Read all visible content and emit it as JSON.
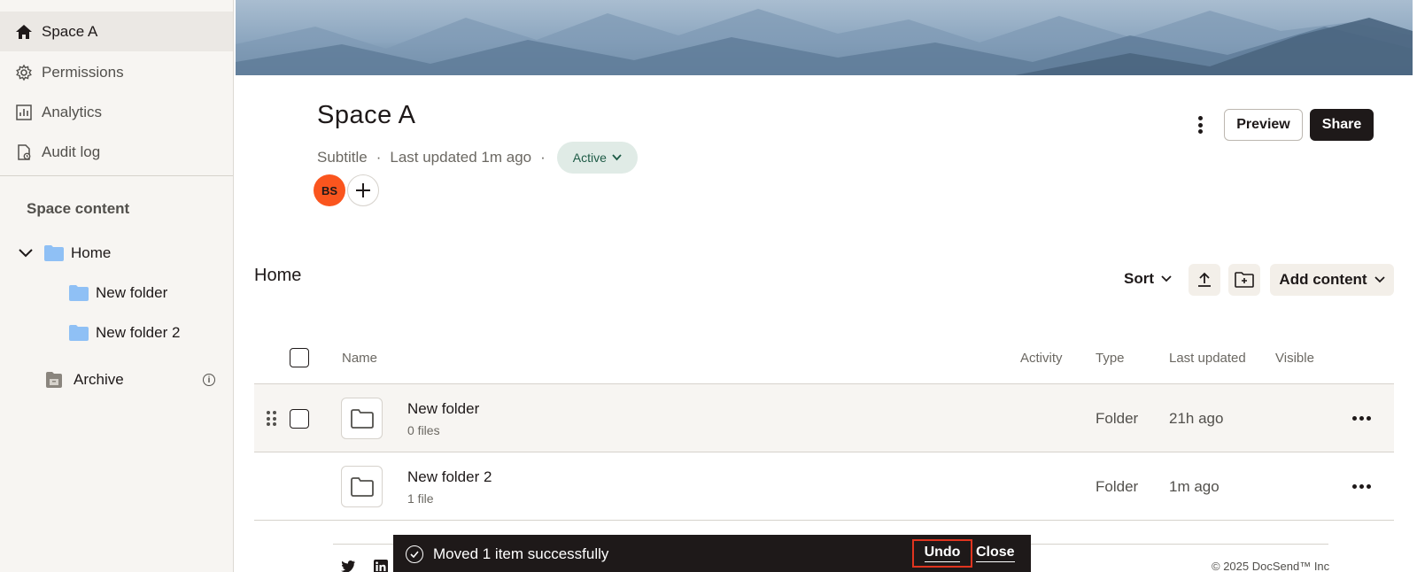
{
  "sidebar": {
    "nav": [
      {
        "label": "Space A",
        "icon": "home-icon",
        "active": true
      },
      {
        "label": "Permissions",
        "icon": "gear-icon"
      },
      {
        "label": "Analytics",
        "icon": "chart-icon"
      },
      {
        "label": "Audit log",
        "icon": "audit-log-icon"
      }
    ],
    "section_title": "Space content",
    "tree": {
      "home": "Home",
      "children": [
        "New folder",
        "New folder 2"
      ],
      "archive": "Archive"
    }
  },
  "header": {
    "title": "Space A",
    "subtitle": "Subtitle",
    "last_updated": "Last updated 1m ago",
    "status": "Active",
    "avatar_initials": "BS",
    "preview_label": "Preview",
    "share_label": "Share"
  },
  "toolbar": {
    "folder_title": "Home",
    "sort_label": "Sort",
    "add_content_label": "Add content"
  },
  "table": {
    "columns": [
      "Name",
      "Activity",
      "Type",
      "Last updated",
      "Visible"
    ],
    "rows": [
      {
        "name": "New folder",
        "sub": "0 files",
        "type": "Folder",
        "updated": "21h ago"
      },
      {
        "name": "New folder 2",
        "sub": "1 file",
        "type": "Folder",
        "updated": "1m ago"
      }
    ]
  },
  "footer": {
    "copyright": "© 2025 DocSend™ Inc"
  },
  "snackbar": {
    "message": "Moved 1 item successfully",
    "undo_label": "Undo",
    "close_label": "Close"
  },
  "colors": {
    "accent_dark": "#1e1919",
    "status_bg": "#e0ebe6",
    "avatar_bg": "#fa551e",
    "folder_blue": "#8fc0f5",
    "highlight_red": "#e0341f"
  }
}
